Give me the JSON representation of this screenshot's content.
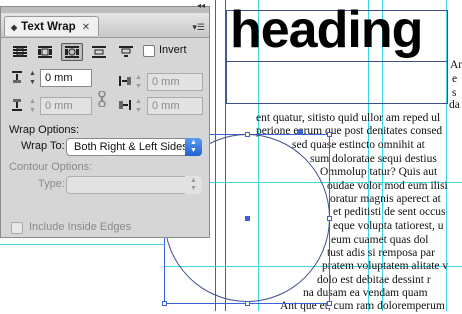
{
  "document": {
    "heading": "heading",
    "text_lines": [
      "Ant",
      "e",
      "s",
      "da",
      "ent quatur, sitisto quid ullor am reped ul",
      "perione earum que post denitates consed",
      "sed quase estincto omnihit at",
      "sum doloratae sequi destius",
      "Ommolup tatur? Quis aut",
      "oudae volor mod eum ilisi",
      "oratur magnis aperect at",
      "et peditisti de sent occus",
      "eque volupta tatiorest, u",
      "eum cuamet quas dol",
      "tust adis si remposa par",
      "pratem voluptatem alitate v",
      "dolo est debitae dessint r",
      "na dusam ea vendam quam",
      "Ant que et, cum ram doloremperum"
    ]
  },
  "panel": {
    "title": "Text Wrap",
    "collapse_icon": "double-chevron-left",
    "menu_icon": "panel-menu",
    "invert_label": "Invert",
    "invert_checked": false,
    "offsets": {
      "top": "0 mm",
      "bottom": "0 mm",
      "left": "0 mm",
      "right": "0 mm"
    },
    "wrap_options_heading": "Wrap Options:",
    "wrap_to_label": "Wrap To:",
    "wrap_to_value": "Both Right & Left Sides",
    "contour_options_heading": "Contour Options:",
    "type_label": "Type:",
    "type_value": "",
    "include_inside_edges_label": "Include Inside Edges",
    "include_inside_edges_checked": false
  },
  "colors": {
    "guide_cyan": "#3fd8e6",
    "frame_blue": "#3a63d8",
    "margin_magenta": "#b02aa8",
    "bleed_red": "#c0392b",
    "select_blue": "#2f74e0"
  }
}
